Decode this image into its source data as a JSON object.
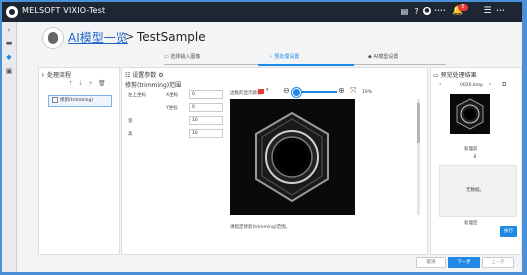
{
  "titlebar": {
    "title": "MELSOFT VIXIO-Test",
    "user_name": "••••",
    "notification_count": "5",
    "right_name": "•••"
  },
  "breadcrumb": {
    "parent": "AI模型一览",
    "separator": ">",
    "current": "TestSample"
  },
  "steps": [
    {
      "label": "选择输入图像",
      "active": false
    },
    {
      "label": "预处理设置",
      "active": true
    },
    {
      "label": "AI模型设置",
      "active": false
    }
  ],
  "flow_panel": {
    "title": "处理流程",
    "item": "修剪(trimming)"
  },
  "settings_panel": {
    "title": "设置参数",
    "section": "修剪(trimming)范围",
    "top_left_label": "左上坐标",
    "x_label": "X坐标",
    "x_value": "0",
    "y_label": "Y坐标",
    "y_value": "0",
    "width_label": "宽",
    "width_value": "10",
    "height_label": "高",
    "height_value": "10"
  },
  "preview": {
    "color_label": "边框的显示颜色",
    "zoom_value": "19%",
    "hint": "请指定修剪(trimming)范围。"
  },
  "result_panel": {
    "title": "预览处理结果",
    "image_name": "0020.bmp",
    "before_label": "处理前",
    "arrow": "⇓",
    "placeholder": "无数据。",
    "after_label": "处理后",
    "run_button": "执行"
  },
  "footer": {
    "cancel": "取消",
    "next": "下一步",
    "back": "上一步"
  }
}
